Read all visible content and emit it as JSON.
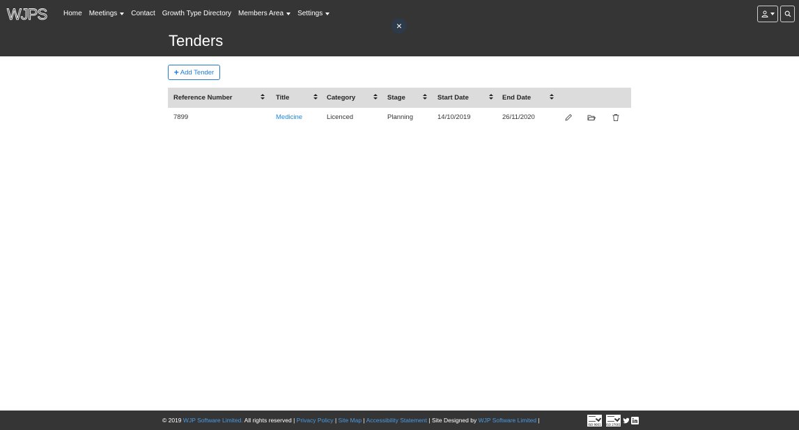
{
  "header": {
    "logo_text": "WJPS",
    "nav": [
      {
        "label": "Home",
        "dropdown": false
      },
      {
        "label": "Meetings",
        "dropdown": true
      },
      {
        "label": "Contact",
        "dropdown": false
      },
      {
        "label": "Growth Type Directory",
        "dropdown": false
      },
      {
        "label": "Members Area",
        "dropdown": true
      },
      {
        "label": "Settings",
        "dropdown": true
      }
    ],
    "close_label": "×",
    "page_title": "Tenders",
    "icons": {
      "user": "user-icon",
      "search": "search-icon"
    }
  },
  "toolbar": {
    "add_button_label": "Add Tender",
    "add_button_icon": "+"
  },
  "table": {
    "columns": [
      "Reference Number",
      "Title",
      "Category",
      "Stage",
      "Start Date",
      "End Date"
    ],
    "rows": [
      {
        "reference_number": "7899",
        "title": "Medicine",
        "category": "Licenced",
        "stage": "Planning",
        "start_date": "14/10/2019",
        "end_date": "26/11/2020",
        "actions": [
          "edit-icon",
          "folder-icon",
          "trash-icon"
        ]
      }
    ]
  },
  "footer": {
    "copyright": "© 2019",
    "company_link": "WJP Software Limited.",
    "rights": "All rights reserved",
    "sep": "|",
    "privacy": "Privacy Policy",
    "sitemap": "Site Map",
    "accessibility": "Accessibility Statement",
    "designed_by": "Site Designed by",
    "designer_link": "WJP Software Limited",
    "certs": [
      "ISO 9001",
      "ISO 27001"
    ],
    "social": [
      "twitter-icon",
      "linkedin-icon"
    ]
  },
  "colors": {
    "header_bg": "#353535",
    "accent": "#1e7bd8",
    "link": "#1e88e5",
    "table_header_bg": "#dcdcdc"
  }
}
